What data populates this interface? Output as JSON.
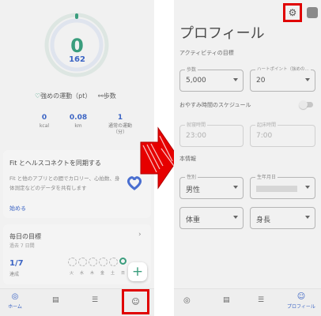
{
  "left": {
    "ring": {
      "big_value": "0",
      "small_value": "162"
    },
    "metrics": {
      "heart_label": "強めの運動（pt）",
      "steps_label": "歩数"
    },
    "stats": [
      {
        "value": "0",
        "unit": "kcal"
      },
      {
        "value": "0.08",
        "unit": "km"
      },
      {
        "value": "1",
        "unit": "通常の運動（分）"
      }
    ],
    "sync_card": {
      "title": "Fit とヘルスコネクトを同期する",
      "body": "Fit と他のアプリとの間でカロリー、心拍数、身体測定などのデータを共有します",
      "action": "始める"
    },
    "goals_card": {
      "title": "毎日の目標",
      "subtitle": "過去 7 日間",
      "ratio": "1/7",
      "ratio_label": "達成",
      "days": [
        "火",
        "水",
        "木",
        "金",
        "土",
        "日"
      ]
    },
    "fab_label": "+",
    "nav": {
      "home": "ホーム"
    }
  },
  "right": {
    "title": "プロフィール",
    "activity_section": "アクティビティの目標",
    "steps_field": {
      "label": "歩数",
      "value": "5,000"
    },
    "heart_field": {
      "label": "ハートポイント（強めの...",
      "value": "20"
    },
    "sleep_section": "おやすみ時間のスケジュール",
    "bed_field": {
      "label": "就寝時間",
      "value": "23:00"
    },
    "wake_field": {
      "label": "起床時間",
      "value": "7:00"
    },
    "about_section": "本情報",
    "gender_field": {
      "label": "性別",
      "value": "男性"
    },
    "birth_field": {
      "label": "生年月日"
    },
    "weight_field": {
      "value": "体重"
    },
    "height_field": {
      "value": "身長"
    },
    "nav": {
      "profile": "プロフィール"
    }
  },
  "colors": {
    "highlight": "#e00000",
    "ring": "#3a9d7d",
    "accent": "#3b64c4"
  }
}
